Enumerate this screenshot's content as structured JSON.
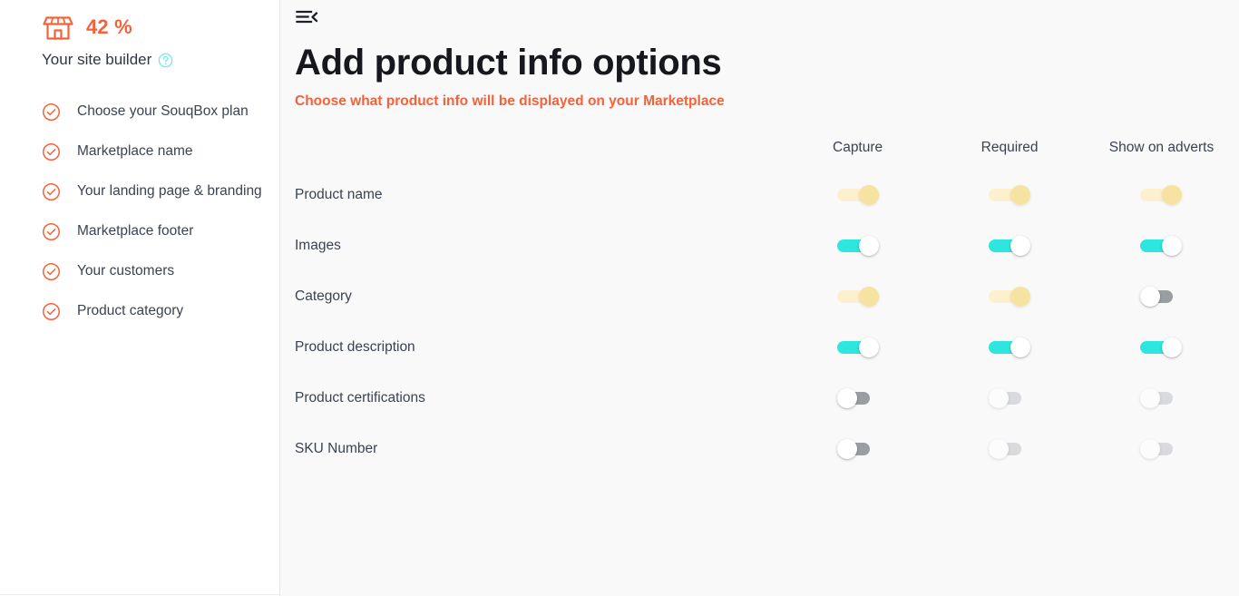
{
  "sidebar": {
    "progress_percent": "42 %",
    "shop_icon": "storefront-icon",
    "builder_title": "Your site builder",
    "help_icon": "help-circle-icon",
    "accent_color": "#f4623a",
    "help_color": "#6fe9ea",
    "items": [
      {
        "label": "Choose your SouqBox plan",
        "icon": "check-circle-icon",
        "complete": true
      },
      {
        "label": "Marketplace name",
        "icon": "check-circle-icon",
        "complete": true
      },
      {
        "label": "Your landing page & branding",
        "icon": "check-circle-icon",
        "complete": true
      },
      {
        "label": "Marketplace footer",
        "icon": "check-circle-icon",
        "complete": true
      },
      {
        "label": "Your customers",
        "icon": "check-circle-icon",
        "complete": true
      },
      {
        "label": "Product category",
        "icon": "check-circle-icon",
        "complete": true
      }
    ]
  },
  "main": {
    "collapse_icon": "collapse-sidebar-icon",
    "title": "Add product info options",
    "subtitle": "Choose what product info will be displayed on your Marketplace",
    "table": {
      "headers": [
        "",
        "Capture",
        "Required",
        "Show on adverts"
      ],
      "rows": [
        {
          "label": "Product name",
          "toggles": [
            {
              "column": "Capture",
              "state": "on",
              "style": "on-amber"
            },
            {
              "column": "Required",
              "state": "on",
              "style": "on-amber"
            },
            {
              "column": "Show on adverts",
              "state": "on",
              "style": "on-amber"
            }
          ]
        },
        {
          "label": "Images",
          "toggles": [
            {
              "column": "Capture",
              "state": "on",
              "style": "on-cyan"
            },
            {
              "column": "Required",
              "state": "on",
              "style": "on-cyan"
            },
            {
              "column": "Show on adverts",
              "state": "on",
              "style": "on-cyan"
            }
          ]
        },
        {
          "label": "Category",
          "toggles": [
            {
              "column": "Capture",
              "state": "on",
              "style": "on-amber"
            },
            {
              "column": "Required",
              "state": "on",
              "style": "on-amber"
            },
            {
              "column": "Show on adverts",
              "state": "off",
              "style": "off-dark"
            }
          ]
        },
        {
          "label": "Product description",
          "toggles": [
            {
              "column": "Capture",
              "state": "on",
              "style": "on-cyan"
            },
            {
              "column": "Required",
              "state": "on",
              "style": "on-cyan"
            },
            {
              "column": "Show on adverts",
              "state": "on",
              "style": "on-cyan"
            }
          ]
        },
        {
          "label": "Product certifications",
          "toggles": [
            {
              "column": "Capture",
              "state": "off",
              "style": "off-dark"
            },
            {
              "column": "Required",
              "state": "off",
              "style": "off-light"
            },
            {
              "column": "Show on adverts",
              "state": "off",
              "style": "off-light"
            }
          ]
        },
        {
          "label": "SKU Number",
          "toggles": [
            {
              "column": "Capture",
              "state": "off",
              "style": "off-dark"
            },
            {
              "column": "Required",
              "state": "off",
              "style": "off-light"
            },
            {
              "column": "Show on adverts",
              "state": "off",
              "style": "off-light"
            }
          ]
        }
      ]
    }
  },
  "colors": {
    "accent": "#f4623a",
    "toggle_on": "#2ee6e0",
    "toggle_on_locked": "#f7e3a1",
    "toggle_off": "#9a9ea3",
    "toggle_off_disabled": "#d8dadd",
    "text": "#3b4350",
    "title": "#16181d"
  }
}
